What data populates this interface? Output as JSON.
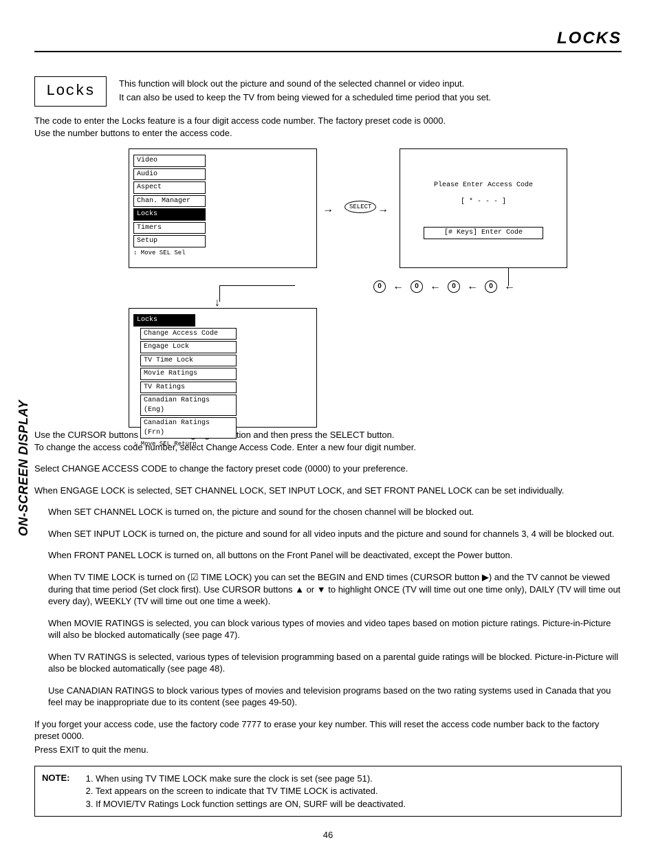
{
  "header": "LOCKS",
  "side_tab": "ON-SCREEN DISPLAY",
  "section_title": "Locks",
  "intro1": "This function will block out the picture and sound of the selected channel or video input.",
  "intro2": "It can also be used to keep the TV from being viewed for a scheduled time period that you set.",
  "code_p1": "The code to enter the Locks feature is a four digit access code number.  The factory preset code is 0000.",
  "code_p2": "Use the number buttons to enter the access code.",
  "osd1": {
    "items": [
      "Video",
      "Audio",
      "Aspect",
      "Chan. Manager",
      "Locks",
      "Timers",
      "Setup"
    ],
    "selected": "Locks",
    "hint": "↕ Move  SEL Sel"
  },
  "select_btn": "SELECT",
  "osd2": {
    "l1": "Please Enter Access Code",
    "l2": "[ * - - - ]",
    "l3": "[# Keys] Enter Code"
  },
  "zero": "0",
  "osd3": {
    "title": "Locks",
    "items": [
      "Change Access Code",
      "Engage Lock",
      "TV Time Lock",
      "Movie Ratings",
      "TV Ratings",
      "Canadian Ratings (Eng)",
      "Canadian Ratings (Frn)"
    ],
    "hint": "↕ Move  SEL Return"
  },
  "p_cursor_a": "Use the CURSOR buttons ",
  "p_cursor_b": " or ",
  "p_cursor_c": " to highlight function and then press the SELECT button.",
  "p_change": "To change the access code number, select Change Access Code.  Enter a new four digit number.",
  "p_selchange": "Select CHANGE ACCESS CODE to change the factory preset code (0000) to your preference.",
  "p_engage": "When ENGAGE LOCK is selected, SET CHANNEL LOCK, SET INPUT LOCK, and SET FRONT PANEL LOCK can be set individually.",
  "p_channel": "When SET CHANNEL LOCK is turned on, the picture and sound for the chosen channel will be blocked out.",
  "p_input": "When SET INPUT LOCK is turned on, the picture and sound for all video inputs and the picture and sound for channels 3, 4 will be blocked out.",
  "p_front": "When FRONT PANEL LOCK is turned on, all buttons on the Front Panel will be deactivated, except the Power button.",
  "p_tvtime_a": "When TV TIME LOCK is turned on (",
  "p_tvtime_b": " TIME LOCK) you can set the BEGIN and END times (CURSOR button ",
  "p_tvtime_c": ") and the TV cannot be viewed during that time period (Set clock first). Use CURSOR buttons ",
  "p_tvtime_d": " or ",
  "p_tvtime_e": " to highlight ONCE (TV will time out one time only), DAILY (TV will time out every day), WEEKLY (TV will time out one time a week).",
  "p_movie": "When MOVIE RATINGS is selected, you can block various types of movies and video tapes based on motion picture ratings.  Picture-in-Picture will also be blocked automatically (see page 47).",
  "p_tvrat": "When TV RATINGS is selected, various types of television programming based on a parental guide ratings will be blocked. Picture-in-Picture will also be blocked automatically (see page 48).",
  "p_can": "Use CANADIAN RATINGS to block various types of movies and television programs based on the two rating systems used in Canada that you feel may be inappropriate due to its content (see pages 49-50).",
  "p_forget": "If you forget your access code, use the factory code 7777 to erase your key number. This will reset the access code number back to the factory preset 0000.",
  "p_exit": "Press EXIT to quit the menu.",
  "note_label": "NOTE:",
  "notes": [
    "1. When using TV TIME LOCK make sure the clock is set (see page 51).",
    "2. Text appears on the screen to indicate that TV TIME LOCK is activated.",
    "3. If MOVIE/TV Ratings Lock function settings are ON, SURF will be deactivated."
  ],
  "page_num": "46"
}
